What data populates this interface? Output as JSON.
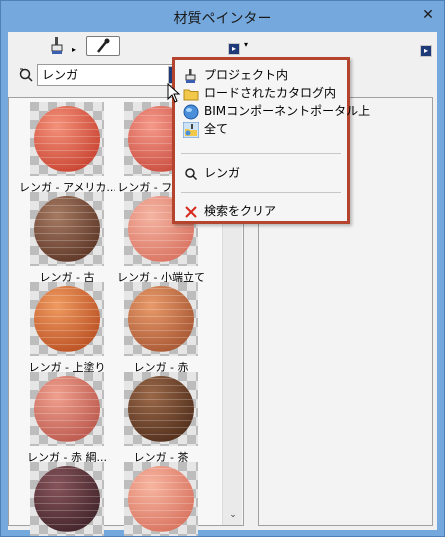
{
  "window": {
    "title": "材質ペインター",
    "close_glyph": "✕"
  },
  "toolbar": {
    "paint_icon": "paint-bucket-icon",
    "eyedropper_icon": "eyedropper-icon",
    "options_arrow": "▸"
  },
  "search": {
    "value": "レンガ",
    "go_arrow": "▸",
    "icon": "magnifier-filter-icon"
  },
  "materials": [
    {
      "label": "レンガ - アメリカ...",
      "colors": [
        "#f4917a",
        "#c6402e"
      ]
    },
    {
      "label": "レンガ - フラン...",
      "colors": [
        "#f5998a",
        "#c7483a"
      ]
    },
    {
      "label": "レンガ - 古",
      "colors": [
        "#a57a62",
        "#5a3324"
      ]
    },
    {
      "label": "レンガ - 小端立て",
      "colors": [
        "#f5b4a2",
        "#d8705e"
      ]
    },
    {
      "label": "レンガ - 上塗り",
      "colors": [
        "#ef9a60",
        "#b84d20"
      ]
    },
    {
      "label": "レンガ - 赤",
      "colors": [
        "#e89a6a",
        "#a45430"
      ]
    },
    {
      "label": "レンガ - 赤 綱...",
      "colors": [
        "#f0a08e",
        "#b8554a"
      ]
    },
    {
      "label": "レンガ - 茶",
      "colors": [
        "#9a6848",
        "#4e2c1a"
      ]
    },
    {
      "label": "",
      "colors": [
        "#86545a",
        "#3e2228"
      ]
    },
    {
      "label": "",
      "colors": [
        "#f7b5a0",
        "#d7705c"
      ]
    }
  ],
  "scrollbar": {
    "up_glyph": "▲",
    "down_glyph": "⌄"
  },
  "menu": {
    "items": [
      {
        "label": "プロジェクト内",
        "icon": "paint-bucket-icon"
      },
      {
        "label": "ロードされたカタログ内",
        "icon": "folder-icon"
      },
      {
        "label": "BIMコンポーネントポータル上",
        "icon": "globe-icon"
      },
      {
        "label": "全て",
        "icon": "all-sources-icon"
      }
    ],
    "search_item": {
      "label": "レンガ",
      "icon": "search-icon"
    },
    "clear_item": {
      "label": "検索をクリア",
      "icon": "clear-x-icon"
    },
    "accent_color": "#b5442f"
  },
  "detail_panel": {
    "options_arrow": "▸"
  }
}
